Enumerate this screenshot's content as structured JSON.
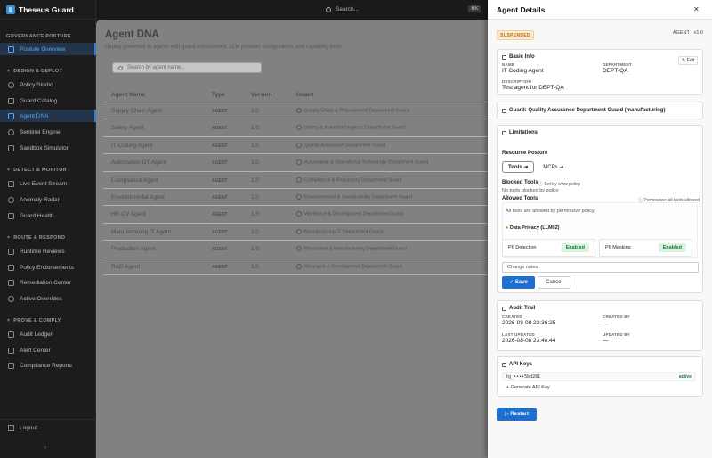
{
  "brand": {
    "name": "Theseus Guard"
  },
  "topbar": {
    "search_placeholder": "Search...",
    "shortcut": "⌘K"
  },
  "sidebar": {
    "sections": [
      {
        "label": "GOVERNANCE POSTURE",
        "items": [
          "Posture Overview"
        ]
      },
      {
        "label": "DESIGN & DEPLOY",
        "items": [
          "Policy Studio",
          "Guard Catalog",
          "Agent DNA",
          "Sentinel Engine",
          "Sandbox Simulator"
        ]
      },
      {
        "label": "DETECT & MONITOR",
        "items": [
          "Live Event Stream",
          "Anomaly Radar",
          "Guard Health"
        ]
      },
      {
        "label": "ROUTE & RESPOND",
        "items": [
          "Runtime Reviews",
          "Policy Endorsements",
          "Remediation Center",
          "Active Overrides"
        ]
      },
      {
        "label": "PROVE & COMPLY",
        "items": [
          "Audit Ledger",
          "Alert Center",
          "Compliance Reports"
        ]
      }
    ],
    "logout": "Logout"
  },
  "main": {
    "title": "Agent DNA",
    "subtitle": "Deploy governed AI agents with guard enforcement, LLM provider configuration, and capability limits.",
    "search_placeholder": "Search by agent name...",
    "columns": [
      "Agent Name",
      "Type",
      "Version",
      "Guard"
    ],
    "rows": [
      {
        "name": "Supply Chain Agent",
        "type": "AGENT",
        "version": "1.0",
        "guard": "Supply Chain & Procurement Department Guard"
      },
      {
        "name": "Safety Agent",
        "type": "AGENT",
        "version": "1.0",
        "guard": "Safety & Industrial Hygiene Department Guard"
      },
      {
        "name": "IT Coding Agent",
        "type": "AGENT",
        "version": "1.0",
        "guard": "Quality Assurance Department Guard"
      },
      {
        "name": "Automation OT Agent",
        "type": "AGENT",
        "version": "1.0",
        "guard": "Automation & Operational Technology Department Guard"
      },
      {
        "name": "Compliance Agent",
        "type": "AGENT",
        "version": "1.0",
        "guard": "Compliance & Regulatory Department Guard"
      },
      {
        "name": "Environmental Agent",
        "type": "AGENT",
        "version": "1.0",
        "guard": "Environmental & Sustainability Department Guard"
      },
      {
        "name": "HR CV Agent",
        "type": "AGENT",
        "version": "1.0",
        "guard": "Workforce & Development Department Guard"
      },
      {
        "name": "Manufacturing IT Agent",
        "type": "AGENT",
        "version": "1.0",
        "guard": "Manufacturing IT Department Guard"
      },
      {
        "name": "Production Agent",
        "type": "AGENT",
        "version": "1.0",
        "guard": "Production & Manufacturing Department Guard"
      },
      {
        "name": "R&D Agent",
        "type": "AGENT",
        "version": "1.0",
        "guard": "Research & Development Department Guard"
      }
    ]
  },
  "drawer": {
    "title": "Agent Details",
    "status": "SUSPENDED",
    "agent_version": "AGENT · v1.0",
    "basic": {
      "title": "Basic Info",
      "edit": "Edit",
      "name_label": "NAME",
      "name": "IT Coding Agent",
      "dept_label": "DEPARTMENT",
      "dept": "DEPT-QA",
      "desc_label": "DESCRIPTION",
      "desc": "Test agent for DEPT-QA"
    },
    "guard": "Guard: Quality Assurance Department Guard (manufacturing)",
    "limits": {
      "title": "Limitations",
      "posture": "Resource Posture",
      "tools": "Tools",
      "mcps": "MCPs",
      "blocked_title": "Blocked Tools",
      "blocked_tag": "Set by www policy",
      "blocked_none": "No tools blocked by policy",
      "allowed_title": "Allowed Tools",
      "allowed_tag": "Permissive: all tools allowed",
      "allowed_text": "All tools are allowed by permissive policy.",
      "llm_title": "Data Privacy (LLM02)",
      "pii_detection": "PII Detection",
      "pii_masking": "PII Masking",
      "enabled": "Enabled",
      "notes_placeholder": "Change notes",
      "save": "Save",
      "cancel": "Cancel"
    },
    "audit": {
      "title": "Audit Trail",
      "created_label": "CREATED",
      "created": "2026-08-08 23:36:25",
      "created_by_label": "CREATED BY",
      "created_by": "—",
      "updated_label": "LAST UPDATED",
      "updated": "2026-08-08 23:48:44",
      "updated_by_label": "UPDATED BY",
      "updated_by": "—"
    },
    "api": {
      "title": "API Keys",
      "key": "tg_••••5bd281",
      "status": "active",
      "generate": "+ Generate API Key"
    },
    "restart": "Restart"
  },
  "colors": {
    "accent": "#1f6fd1",
    "sidebar_active": "#5aa9f0",
    "suspended": "#c36b00",
    "enabled": "#1d7b3b"
  }
}
